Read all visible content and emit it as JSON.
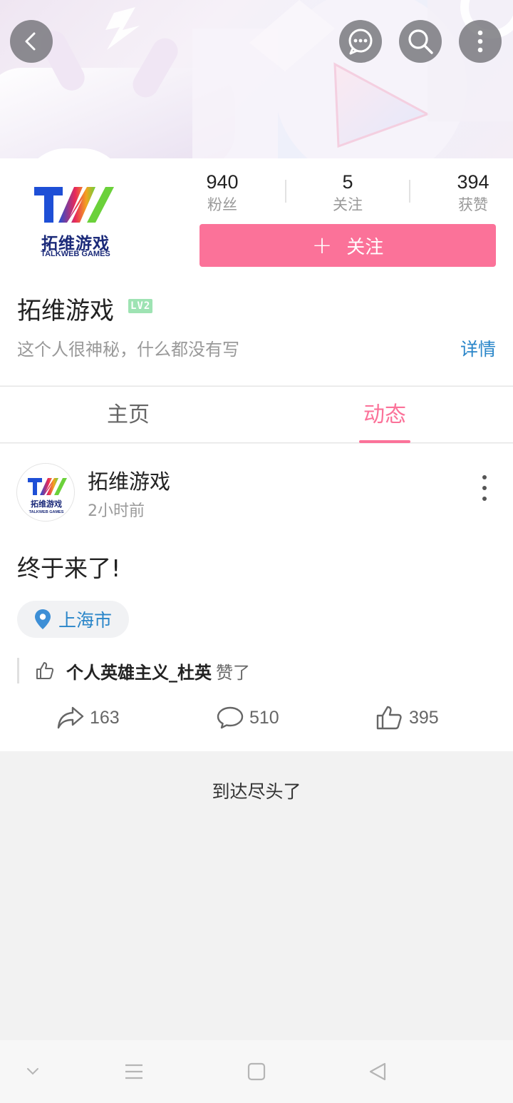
{
  "header": {
    "back_icon": "chevron-left-icon",
    "message_icon": "chat-bubble-icon",
    "search_icon": "search-icon",
    "more_icon": "more-vertical-icon"
  },
  "profile": {
    "logo_text_cn": "拓维游戏",
    "logo_text_en": "TALKWEB GAMES",
    "stats": [
      {
        "value": "940",
        "label": "粉丝"
      },
      {
        "value": "5",
        "label": "关注"
      },
      {
        "value": "394",
        "label": "获赞"
      }
    ],
    "follow_plus": "+",
    "follow_label": "关注",
    "name": "拓维游戏",
    "level": "LV2",
    "bio": "这个人很神秘，什么都没有写",
    "detail_link": "详情"
  },
  "tabs": [
    {
      "label": "主页",
      "active": false
    },
    {
      "label": "动态",
      "active": true
    }
  ],
  "post": {
    "author": "拓维游戏",
    "time": "2小时前",
    "text": "终于来了!",
    "location": "上海市",
    "liked_by": "个人英雄主义_杜英",
    "liked_suffix": "赞了",
    "shares": "163",
    "comments": "510",
    "likes": "395"
  },
  "end_text": "到达尽头了",
  "colors": {
    "accent": "#fb7299",
    "link": "#2a86c9",
    "level_badge": "#9ee3b3"
  }
}
